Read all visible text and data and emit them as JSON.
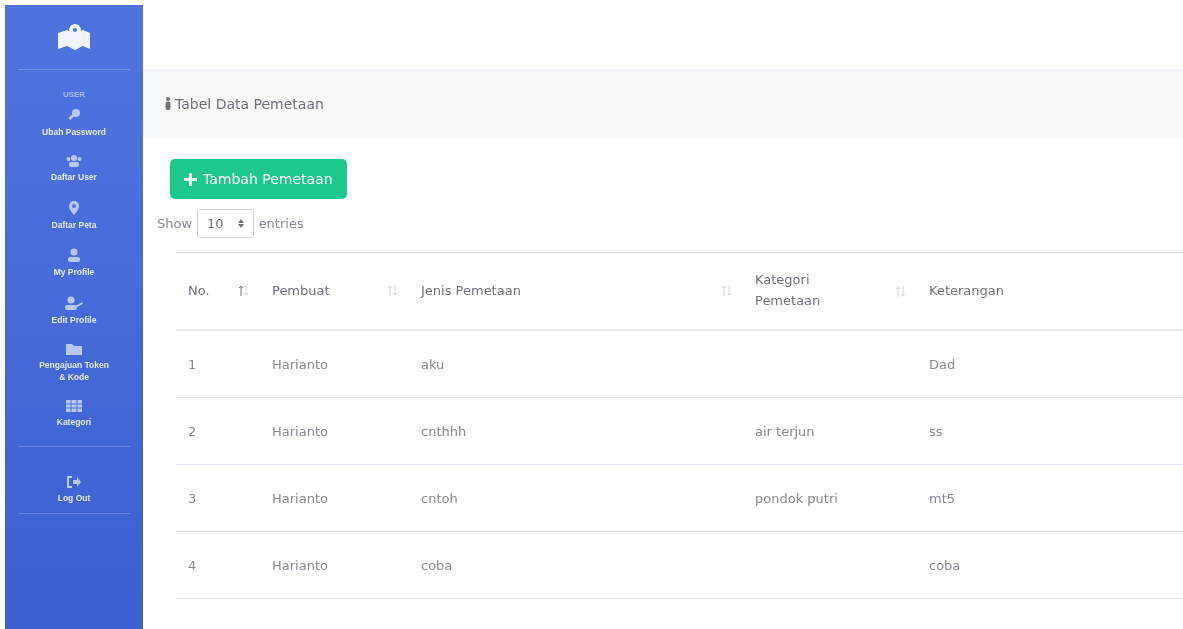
{
  "sidebar": {
    "section_label": "USER",
    "items": [
      {
        "label": "Ubah Password"
      },
      {
        "label": "Daftar User"
      },
      {
        "label": "Daftar Peta"
      },
      {
        "label": "My Profile"
      },
      {
        "label": "Edit Profile"
      },
      {
        "label": "Pengajuan Token & Kode"
      },
      {
        "label": "Kategori"
      }
    ],
    "logout": {
      "label": "Log Out"
    }
  },
  "page_header": {
    "title": "Tabel Data Pemetaan"
  },
  "add_button": {
    "label": "Tambah Pemetaan"
  },
  "length_control": {
    "prefix": "Show",
    "value": "10",
    "suffix": "entries"
  },
  "table": {
    "columns": [
      {
        "label": "No.",
        "sorted": true
      },
      {
        "label": "Pembuat",
        "sorted": false
      },
      {
        "label": "Jenis Pemetaan",
        "sorted": false
      },
      {
        "label": "Kategori Pemetaan",
        "sorted": false
      },
      {
        "label": "Keterangan"
      }
    ],
    "rows": [
      [
        "1",
        "Harianto",
        "aku",
        "",
        "Dad"
      ],
      [
        "2",
        "Harianto",
        "cnthhh",
        "air terjun",
        "ss"
      ],
      [
        "3",
        "Harianto",
        "cntoh",
        "pondok putri",
        "mt5"
      ],
      [
        "4",
        "Harianto",
        "coba",
        "",
        "coba"
      ]
    ]
  }
}
